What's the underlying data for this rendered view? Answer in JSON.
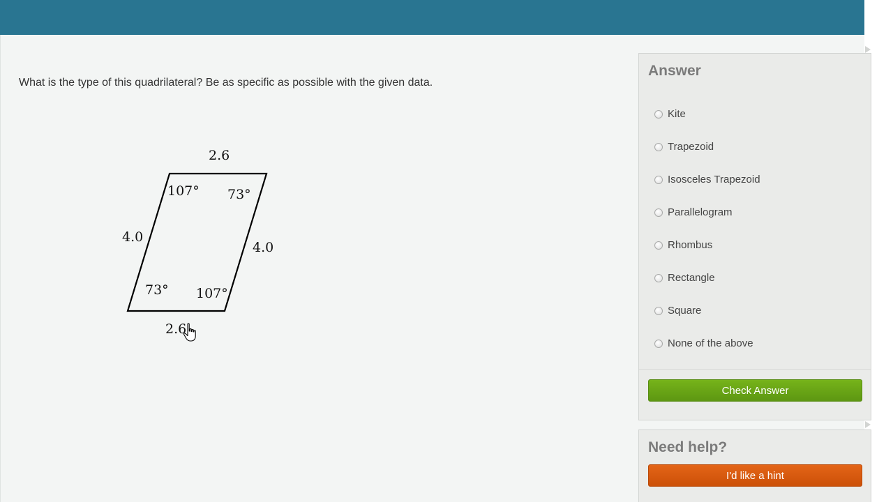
{
  "question": {
    "text": "What is the type of this quadrilateral? Be as specific as possible with the given data."
  },
  "figure": {
    "top_side": "2.6",
    "bottom_side": "2.6",
    "left_side": "4.0",
    "right_side": "4.0",
    "angle_top_left": "107°",
    "angle_top_right": "73°",
    "angle_bottom_left": "73°",
    "angle_bottom_right": "107°"
  },
  "answer_panel": {
    "title": "Answer",
    "options": [
      {
        "label": "Kite"
      },
      {
        "label": "Trapezoid"
      },
      {
        "label": "Isosceles Trapezoid"
      },
      {
        "label": "Parallelogram"
      },
      {
        "label": "Rhombus"
      },
      {
        "label": "Rectangle"
      },
      {
        "label": "Square"
      },
      {
        "label": "None of the above"
      }
    ],
    "check_button": "Check Answer"
  },
  "help_panel": {
    "title": "Need help?",
    "hint_button": "I'd like a hint"
  },
  "colors": {
    "header": "#297591",
    "check_button": "#6aa517",
    "hint_button": "#d85a0e"
  }
}
